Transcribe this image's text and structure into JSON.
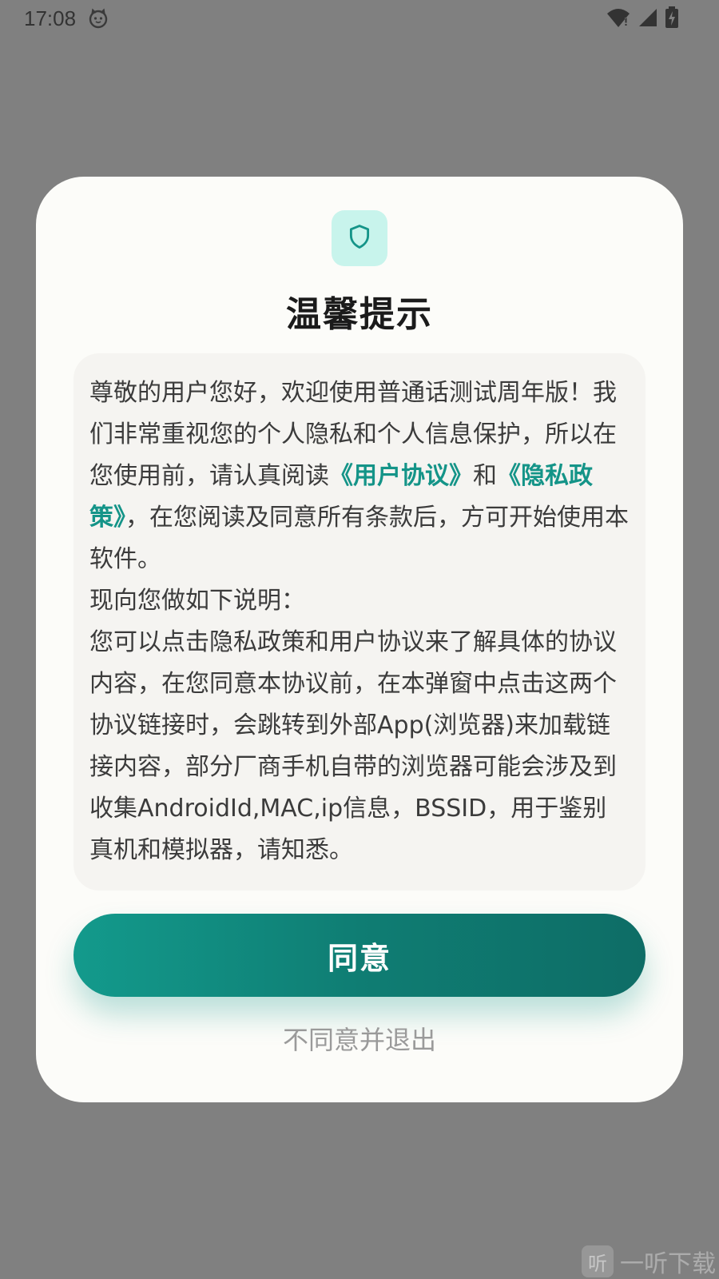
{
  "status_bar": {
    "time": "17:08",
    "icons": [
      "cat-notification-icon",
      "wifi-icon",
      "signal-icon",
      "battery-icon"
    ]
  },
  "dialog": {
    "icon": "shield-icon",
    "title": "温馨提示",
    "body": {
      "p1_part1": "尊敬的用户您好，欢迎使用普通话测试周年版！我们非常重视您的个人隐私和个人信息保护，所以在您使用前，请认真阅读",
      "link_user_agreement": "《用户协议》",
      "p1_and": "和",
      "link_privacy_policy": "《隐私政策》",
      "p1_part2": "，在您阅读及同意所有条款后，方可开始使用本软件。",
      "p2": "现向您做如下说明：",
      "p3": "您可以点击隐私政策和用户协议来了解具体的协议内容，在您同意本协议前，在本弹窗中点击这两个协议链接时，会跳转到外部App(浏览器)来加载链接内容，部分厂商手机自带的浏览器可能会涉及到收集AndroidId,MAC,ip信息，BSSID，用于鉴别真机和模拟器，请知悉。"
    },
    "agree_label": "同意",
    "disagree_label": "不同意并退出"
  },
  "watermark": {
    "logo_text": "听",
    "text": "一听下载"
  },
  "colors": {
    "accent": "#149488",
    "badge_bg": "#c8f4ec",
    "overlay": "#808080"
  }
}
